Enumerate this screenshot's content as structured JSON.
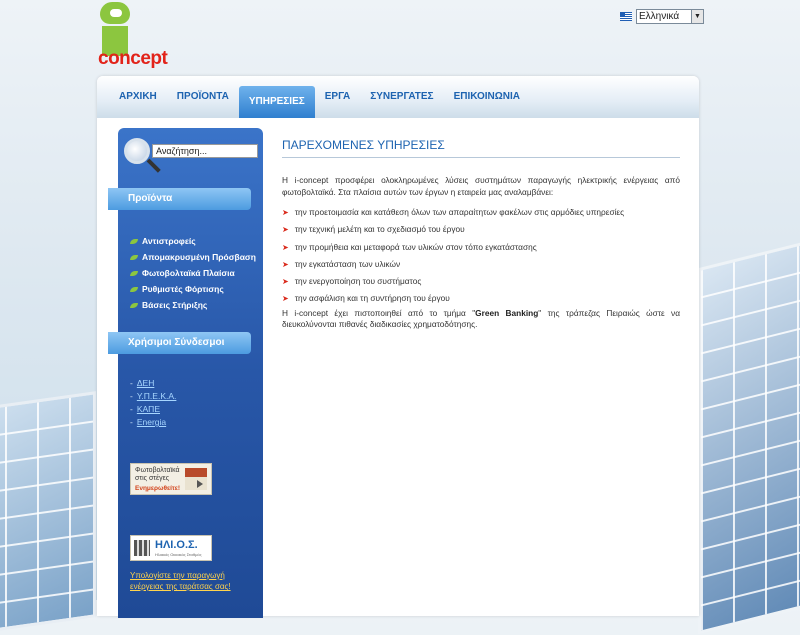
{
  "brand": {
    "logo_text": "concept"
  },
  "language": {
    "label": "Ελληνικά"
  },
  "nav": {
    "items": [
      {
        "label": "ΑΡΧΙΚΗ",
        "active": false
      },
      {
        "label": "ΠΡΟΪΟΝΤΑ",
        "active": false
      },
      {
        "label": "ΥΠΗΡΕΣΙΕΣ",
        "active": true
      },
      {
        "label": "ΕΡΓΑ",
        "active": false
      },
      {
        "label": "ΣΥΝΕΡΓΑΤΕΣ",
        "active": false
      },
      {
        "label": "ΕΠΙΚΟΙΝΩΝΙΑ",
        "active": false
      }
    ]
  },
  "sidebar": {
    "search_value": "Αναζήτηση...",
    "products_title": "Προϊόντα",
    "products": [
      "Αντιστροφείς",
      "Απομακρυσμένη Πρόσβαση",
      "Φωτοβολταϊκά Πλαίσια",
      "Ρυθμιστές Φόρτισης",
      "Βάσεις Στήριξης"
    ],
    "links_title": "Χρήσιμοι Σύνδεσμοι",
    "links": [
      "ΔΕΗ",
      "Υ.Π.Ε.Κ.Α.",
      "ΚΑΠΕ",
      "Energia"
    ],
    "banner1": {
      "line1": "Φωτοβολταϊκά στις στέγες",
      "line2": "Ενημερωθείτε!"
    },
    "banner2": {
      "name": "ΗΛΙ.Ο.Σ.",
      "sub": "Ηλιακός Οικιακός Σταθμός"
    },
    "calc_link": "Υπολογίστε την παραγωγή ενέργειας της ταράτσας σας!"
  },
  "content": {
    "title": "ΠΑΡΕΧΟΜΕΝΕΣ ΥΠΗΡΕΣΙΕΣ",
    "intro": "Η i-concept προσφέρει ολοκληρωμένες λύσεις συστημάτων παραγωγής ηλεκτρικής ενέργειας από φωτοβολταϊκά. Στα πλαίσια αυτών των έργων η εταιρεία μας αναλαμβάνει:",
    "services": [
      "την προετοιμασία και κατάθεση όλων των απαραίτητων φακέλων στις αρμόδιες υπηρεσίες",
      "την τεχνική μελέτη και το σχεδιασμό του έργου",
      "την προμήθεια και μεταφορά των υλικών στον τόπο εγκατάστασης",
      "την εγκατάσταση των υλικών",
      "την ενεργοποίηση του συστήματος",
      "την ασφάλιση και τη συντήρηση του έργου"
    ],
    "outro_before": "Η i-concept έχει πιστοποιηθεί από το τμήμα \"",
    "outro_bold": "Green Banking",
    "outro_after": "\" της τράπεζας Πειραιώς ώστε να διευκολύνονται πιθανές διαδικασίες χρηματοδότησης."
  },
  "colors": {
    "accent": "#1d63b0",
    "sidebar": "#2857a8",
    "logo_green": "#8cc63f",
    "logo_red": "#e2231a"
  }
}
